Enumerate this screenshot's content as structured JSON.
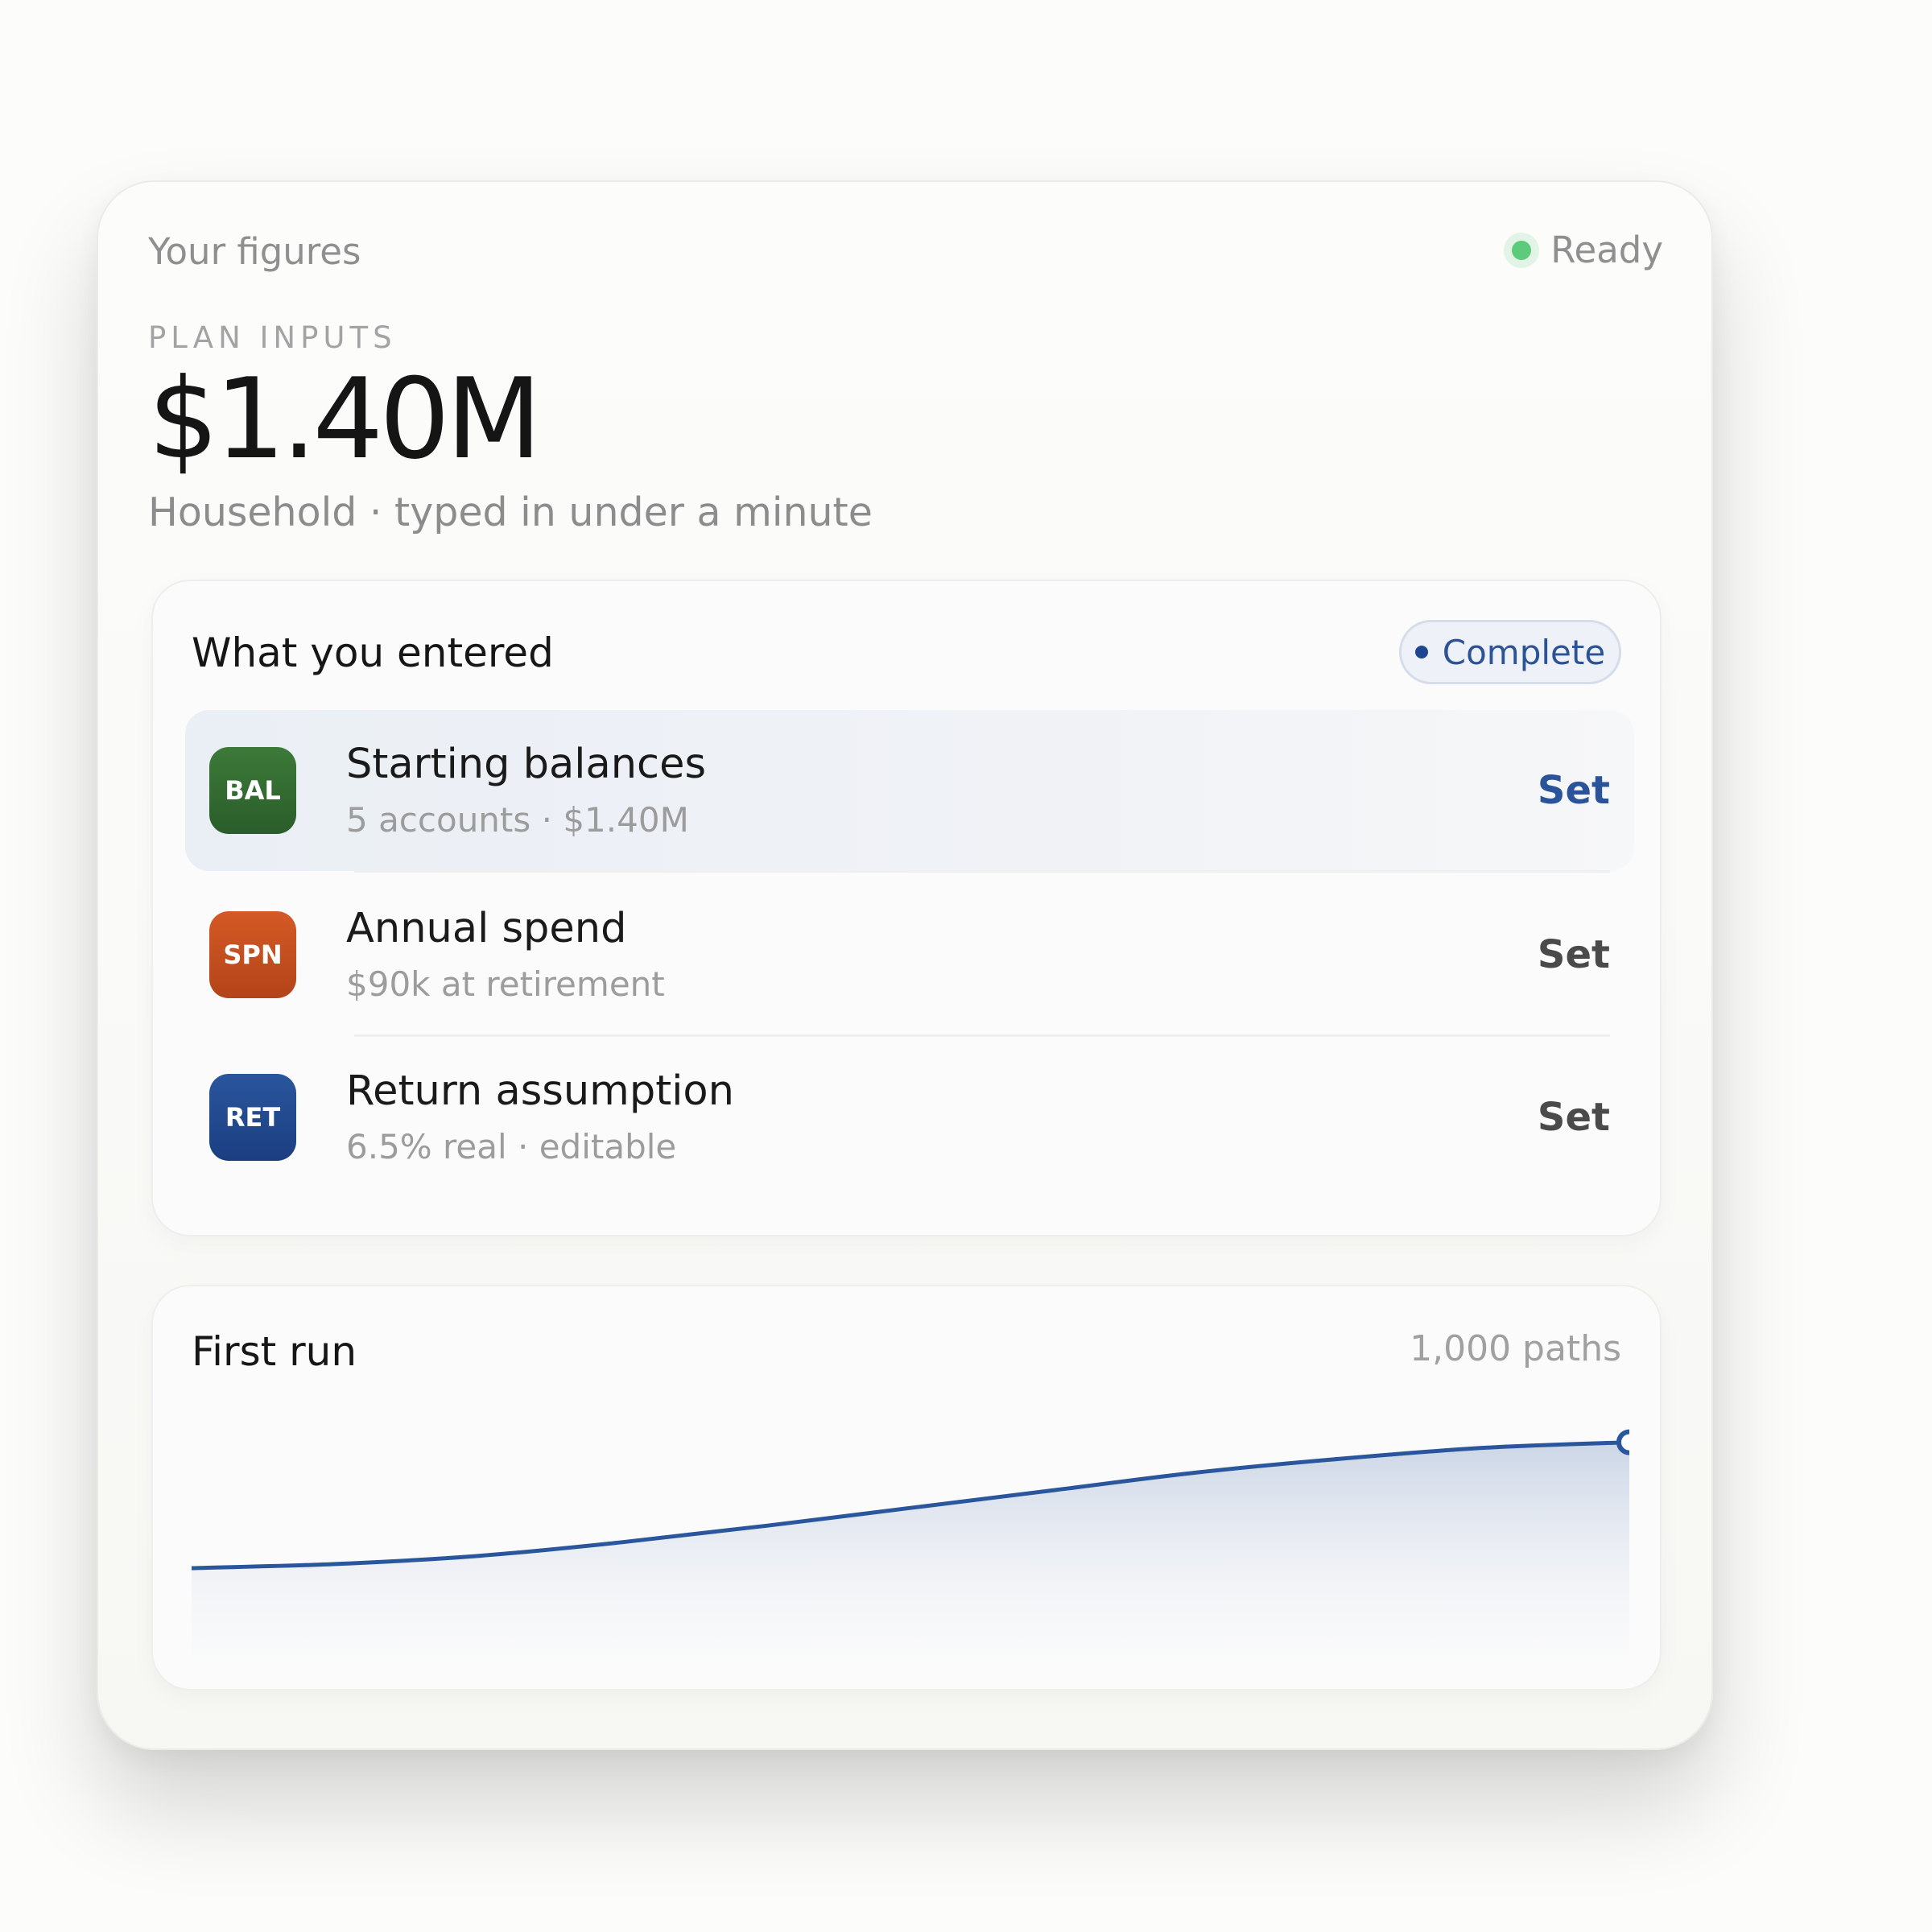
{
  "header": {
    "title": "Your figures",
    "status": "Ready"
  },
  "summary": {
    "eyebrow": "PLAN INPUTS",
    "amount": "$1.40M",
    "subtitle": "Household · typed in under a minute"
  },
  "entered": {
    "title": "What you entered",
    "status": "Complete",
    "rows": [
      {
        "badge": "BAL",
        "title": "Starting balances",
        "subtitle": "5 accounts · $1.40M",
        "action": "Set",
        "color": "#2f6a2f"
      },
      {
        "badge": "SPN",
        "title": "Annual spend",
        "subtitle": "$90k at retirement",
        "action": "Set",
        "color": "#c24d1f"
      },
      {
        "badge": "RET",
        "title": "Return assumption",
        "subtitle": "6.5% real · editable",
        "action": "Set",
        "color": "#22498f"
      }
    ]
  },
  "first_run": {
    "title": "First run",
    "meta": "1,000 paths"
  },
  "chart_data": {
    "type": "area",
    "x": [
      0,
      0.1,
      0.2,
      0.3,
      0.4,
      0.5,
      0.6,
      0.7,
      0.8,
      0.9,
      1.0
    ],
    "values": [
      0.0,
      0.03,
      0.09,
      0.19,
      0.31,
      0.44,
      0.57,
      0.7,
      0.8,
      0.88,
      0.92
    ],
    "title": "",
    "xlabel": "",
    "ylabel": "",
    "grid": false,
    "legend": "none",
    "line_color": "#2a569d"
  },
  "colors": {
    "accent": "#2a5399",
    "ready": "#5ccb7b"
  }
}
